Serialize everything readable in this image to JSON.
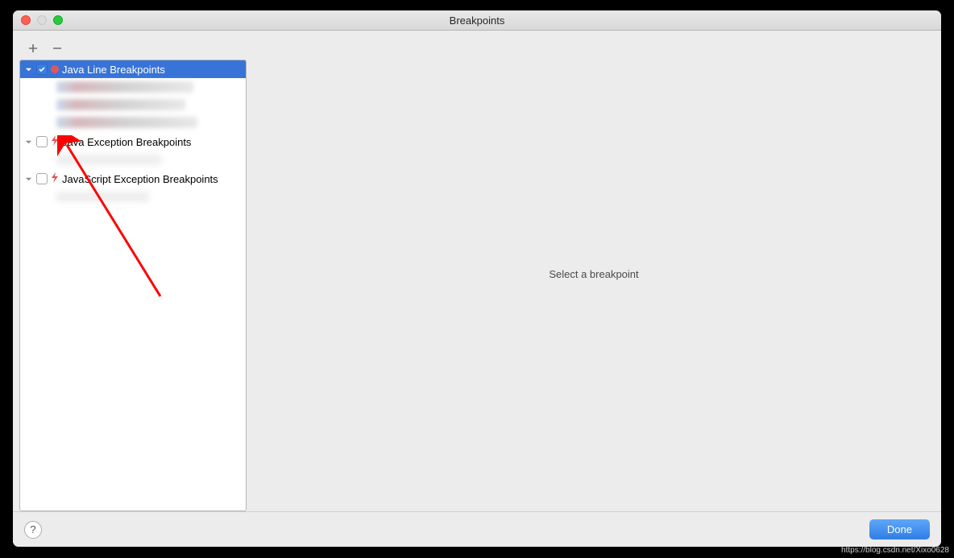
{
  "window": {
    "title": "Breakpoints"
  },
  "tree": {
    "categories": [
      {
        "label": "Java Line Breakpoints",
        "checked": true,
        "selected": true,
        "icon": "circle"
      },
      {
        "label": "Java Exception Breakpoints",
        "checked": false,
        "selected": false,
        "icon": "lightning"
      },
      {
        "label": "JavaScript Exception Breakpoints",
        "checked": false,
        "selected": false,
        "icon": "lightning"
      }
    ]
  },
  "rightPanel": {
    "placeholder": "Select a breakpoint"
  },
  "buttons": {
    "done": "Done",
    "help": "?"
  },
  "watermark": "https://blog.csdn.net/Xixo0628"
}
